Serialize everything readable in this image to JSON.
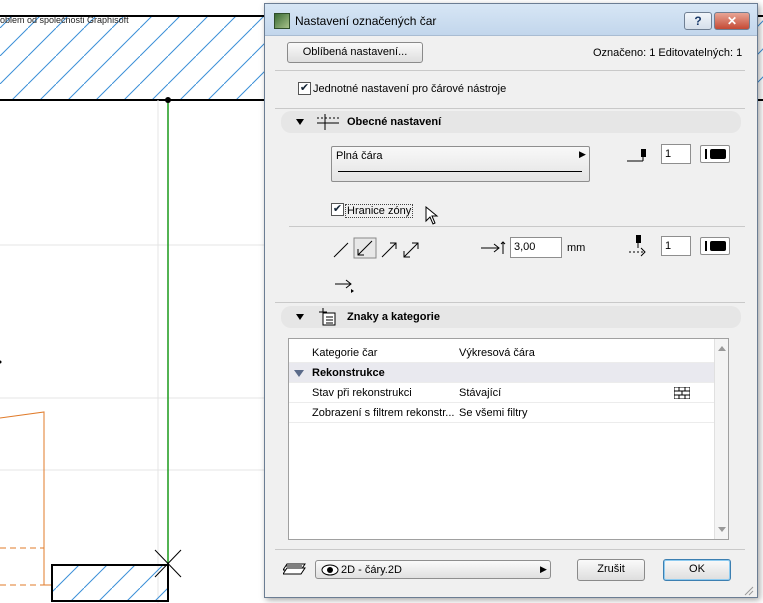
{
  "background": {
    "note_text": "oblem od společnosti Graphisoft"
  },
  "dialog": {
    "title": "Nastavení označených čar",
    "help_label": "?",
    "close_label": "✕",
    "favorites_label": "Oblíbená nastavení...",
    "selection_info": "Označeno: 1 Editovatelných: 1",
    "uniform_label": "Jednotné nastavení pro čárové nástroje",
    "uniform_checked": true,
    "general": {
      "title": "Obecné nastavení",
      "line_type": "Plná čára",
      "pen_number": "1",
      "zone_border_label": "Hranice zóny",
      "zone_border_checked": true,
      "arrow_size": "3,00",
      "arrow_unit": "mm",
      "arrow_pen_number": "1"
    },
    "categories": {
      "title": "Znaky a kategorie",
      "rows": [
        {
          "key": "Kategorie čar",
          "value": "Výkresová čára"
        },
        {
          "group": "Rekonstrukce"
        },
        {
          "key": "Stav při rekonstrukci",
          "value": "Stávající"
        },
        {
          "key": "Zobrazení s filtrem rekonstr...",
          "value": "Se všemi filtry"
        }
      ]
    },
    "footer": {
      "layer_label": "2D - čáry.2D",
      "cancel_label": "Zrušit",
      "ok_label": "OK"
    }
  }
}
